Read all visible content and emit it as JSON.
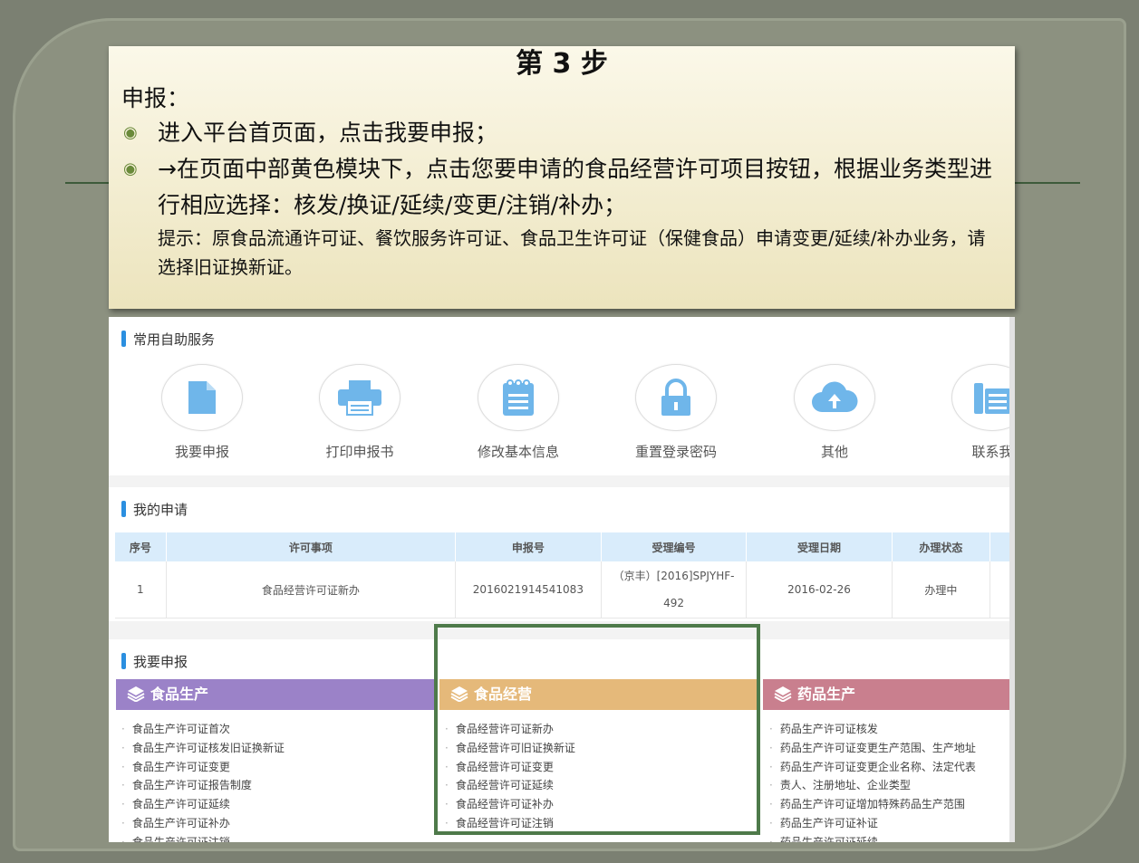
{
  "callout": {
    "title": "第 3 步",
    "intro": "申报：",
    "bullets": [
      "进入平台首页面，点击我要申报；",
      "→在页面中部黄色模块下，点击您要申请的食品经营许可项目按钮，根据业务类型进行相应选择：核发/换证/延续/变更/注销/补办；"
    ],
    "hint": "提示：原食品流通许可证、餐饮服务许可证、食品卫生许可证（保健食品）申请变更/延续/补办业务，请选择旧证换新证。"
  },
  "services": {
    "heading": "常用自助服务",
    "items": [
      {
        "label": "我要申报",
        "icon": "document-icon"
      },
      {
        "label": "打印申报书",
        "icon": "printer-icon"
      },
      {
        "label": "修改基本信息",
        "icon": "notepad-icon"
      },
      {
        "label": "重置登录密码",
        "icon": "lock-icon"
      },
      {
        "label": "其他",
        "icon": "cloud-upload-icon"
      },
      {
        "label": "联系我",
        "icon": "fax-icon"
      }
    ]
  },
  "applications": {
    "heading": "我的申请",
    "columns": [
      "序号",
      "许可事项",
      "申报号",
      "受理编号",
      "受理日期",
      "办理状态"
    ],
    "rows": [
      {
        "no": "1",
        "item": "食品经营许可证新办",
        "report_no": "2016021914541083",
        "accept_no_line1": "（京丰）[2016]SPJYHF-",
        "accept_no_line2": "492",
        "date": "2016-02-26",
        "status": "办理中"
      }
    ]
  },
  "declare": {
    "heading": "我要申报",
    "categories": [
      {
        "title": "食品生产",
        "color": "#9b82c8",
        "items": [
          "食品生产许可证首次",
          "食品生产许可证核发旧证换新证",
          "食品生产许可证变更",
          "食品生产许可证报告制度",
          "食品生产许可证延续",
          "食品生产许可证补办",
          "食品生产许可证注销"
        ]
      },
      {
        "title": "食品经营",
        "color": "#e5b97a",
        "items": [
          "食品经营许可证新办",
          "食品经营许可旧证换新证",
          "食品经营许可证变更",
          "食品经营许可证延续",
          "食品经营许可证补办",
          "食品经营许可证注销"
        ]
      },
      {
        "title": "药品生产",
        "color": "#c97f8e",
        "items": [
          "药品生产许可证核发",
          "药品生产许可证变更生产范围、生产地址",
          "药品生产许可证变更企业名称、法定代表",
          "责人、注册地址、企业类型",
          "药品生产许可证增加特殊药品生产范围",
          "药品生产许可证补证",
          "药品生产许可证延续"
        ]
      }
    ]
  }
}
